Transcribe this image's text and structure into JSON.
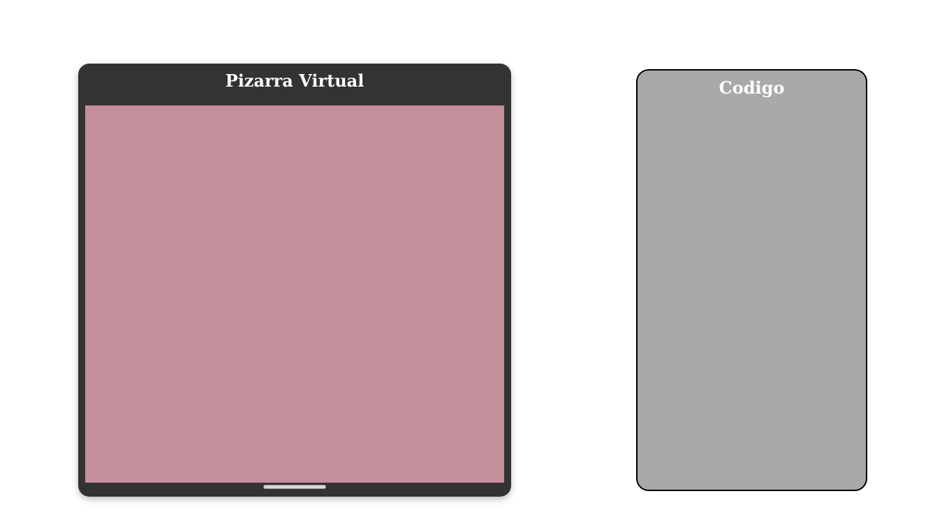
{
  "whiteboard": {
    "title": "Pizarra Virtual",
    "canvas_color": "#c48f9b",
    "frame_color": "#333333"
  },
  "code_panel": {
    "title": "Codigo",
    "content": "",
    "background_color": "#a9a9a9"
  }
}
